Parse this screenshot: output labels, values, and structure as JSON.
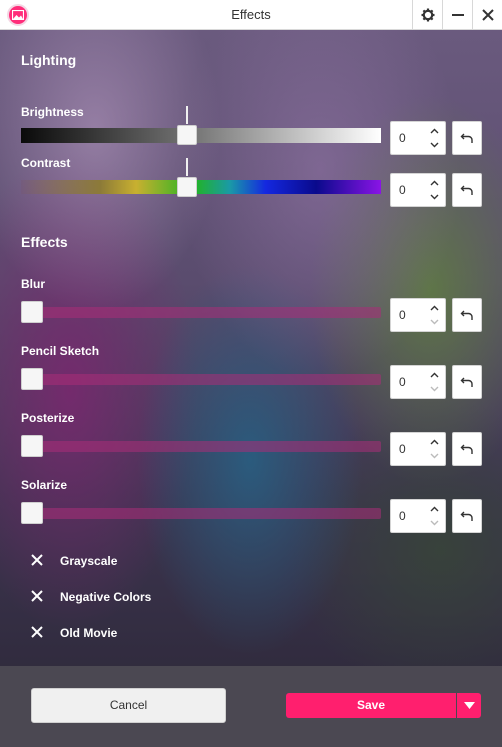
{
  "window": {
    "title": "Effects",
    "icons": {
      "app": "app-logo-icon",
      "settings": "gear-icon",
      "minimize": "minimize-icon",
      "close": "close-icon"
    }
  },
  "lighting": {
    "heading": "Lighting",
    "brightness": {
      "label": "Brightness",
      "value": "0",
      "level": 0.5
    },
    "contrast": {
      "label": "Contrast",
      "value": "0",
      "level": 0.5
    }
  },
  "effects": {
    "heading": "Effects",
    "blur": {
      "label": "Blur",
      "value": "0",
      "level": 0
    },
    "pencil_sketch": {
      "label": "Pencil Sketch",
      "value": "0",
      "level": 0
    },
    "posterize": {
      "label": "Posterize",
      "value": "0",
      "level": 0
    },
    "solarize": {
      "label": "Solarize",
      "value": "0",
      "level": 0
    }
  },
  "toggles": [
    {
      "label": "Grayscale",
      "icon": "x-icon"
    },
    {
      "label": "Negative Colors",
      "icon": "x-icon"
    },
    {
      "label": "Old Movie",
      "icon": "x-icon"
    }
  ],
  "footer": {
    "cancel_label": "Cancel",
    "save_label": "Save"
  },
  "colors": {
    "accent": "#ff1f6e",
    "footer_bg": "#4b4852",
    "effect_track": "#aa2d78"
  }
}
